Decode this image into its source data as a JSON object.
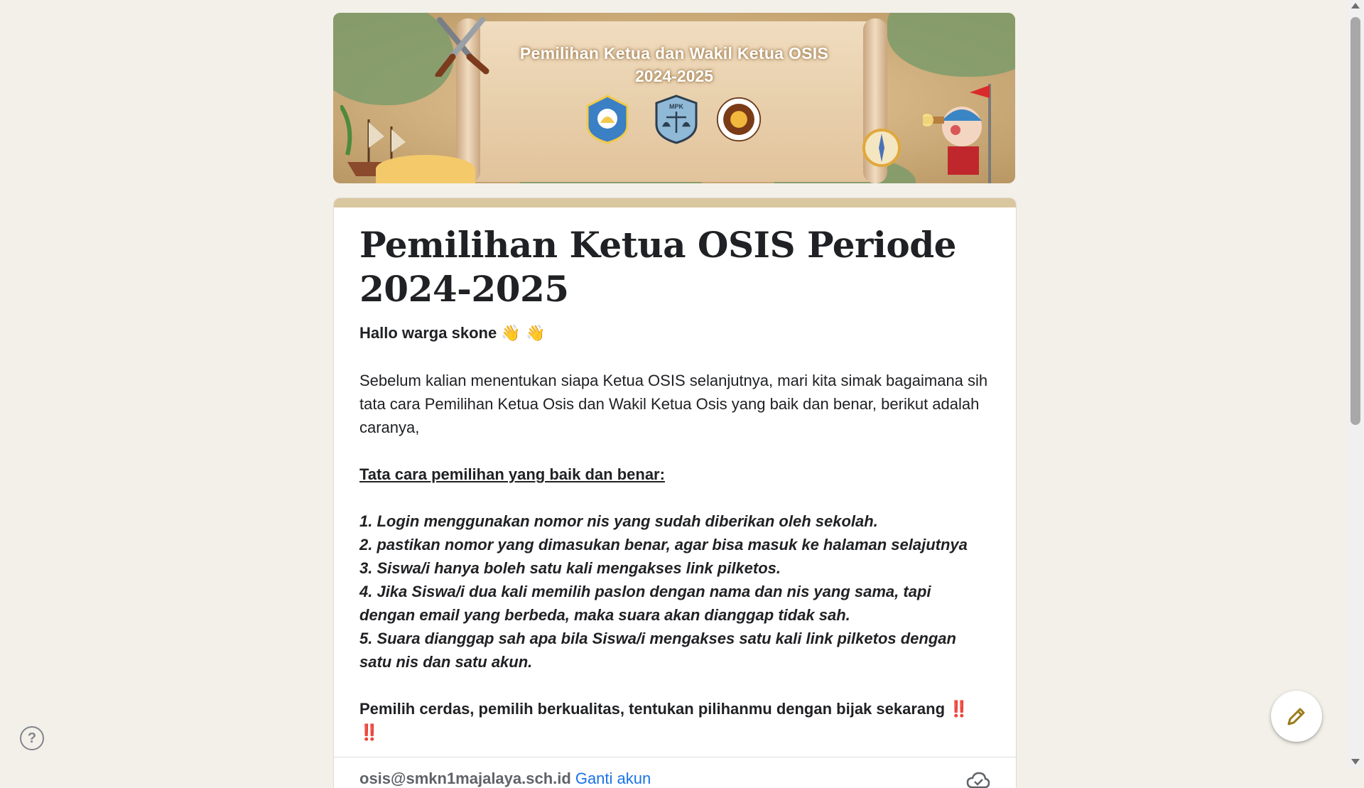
{
  "banner": {
    "line1": "Pemilihan Ketua dan Wakil Ketua OSIS",
    "line2": "2024-2025",
    "logos": [
      "osis-logo",
      "mpk-logo",
      "school-logo"
    ]
  },
  "form": {
    "title": "Pemilihan Ketua OSIS Periode 2024-2025",
    "greeting": "Hallo warga skone",
    "greeting_emoji": "👋 👋",
    "intro": "Sebelum kalian menentukan siapa Ketua OSIS selanjutnya, mari kita simak bagaimana sih tata cara Pemilihan Ketua Osis dan Wakil Ketua Osis yang baik dan benar, berikut adalah caranya,",
    "rules_heading": "Tata cara pemilihan yang baik dan benar:",
    "rules": [
      "1. Login menggunakan nomor nis yang sudah diberikan oleh sekolah.",
      "2. pastikan nomor yang dimasukan benar, agar bisa masuk ke halaman selajutnya",
      "3. Siswa/i hanya boleh satu kali mengakses link pilketos.",
      "4. Jika Siswa/i dua kali memilih paslon dengan nama dan nis yang sama, tapi dengan email yang berbeda, maka suara akan dianggap tidak sah.",
      "5. Suara dianggap sah apa bila Siswa/i mengakses satu kali link pilketos dengan satu nis dan satu akun."
    ],
    "closing": "Pemilih cerdas, pemilih berkualitas, tentukan pilihanmu dengan bijak sekarang",
    "closing_emoji": "‼️ ‼️"
  },
  "account": {
    "email": "osis@smkn1majalaya.sch.id",
    "switch_label": "Ganti akun"
  },
  "icons": {
    "help": "?",
    "edit": "pencil-icon",
    "cloud": "cloud-sync-icon"
  },
  "colors": {
    "background": "#f3f0e9",
    "accent_bar": "#d9c7a0",
    "link": "#1a73e8",
    "alarm": "#e03a4a"
  }
}
